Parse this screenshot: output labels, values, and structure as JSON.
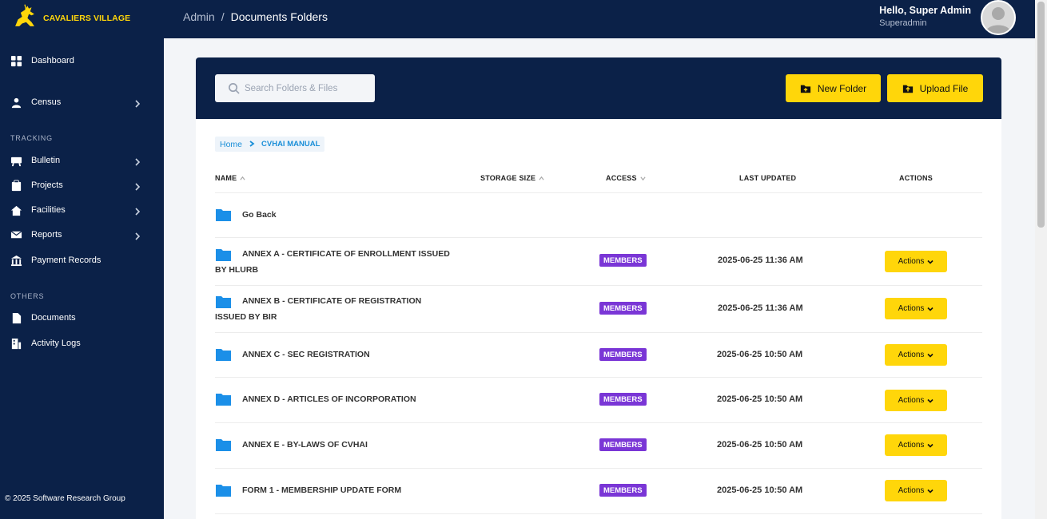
{
  "brand": {
    "name": "CAVALIERS VILLAGE",
    "accent": "#ffd60a",
    "navy": "#0b2148"
  },
  "sidebar": {
    "items": [
      {
        "label": "Dashboard",
        "icon": "grid-icon",
        "has_children": false
      },
      {
        "label": "Census",
        "icon": "person-icon",
        "has_children": true
      }
    ],
    "section_tracking": "TRACKING",
    "tracking_items": [
      {
        "label": "Bulletin",
        "icon": "easel-icon",
        "has_children": true
      },
      {
        "label": "Projects",
        "icon": "clipboard-icon",
        "has_children": true
      },
      {
        "label": "Facilities",
        "icon": "house-icon",
        "has_children": true
      },
      {
        "label": "Reports",
        "icon": "mail-check-icon",
        "has_children": true
      },
      {
        "label": "Payment Records",
        "icon": "bank-icon",
        "has_children": false
      }
    ],
    "section_others": "OTHERS",
    "others_items": [
      {
        "label": "Documents",
        "icon": "document-icon",
        "has_children": false
      },
      {
        "label": "Activity Logs",
        "icon": "building-icon",
        "has_children": false
      }
    ],
    "copyright": "© 2025 Software Research Group"
  },
  "header": {
    "crumb_root": "Admin",
    "crumb_sep": "/",
    "crumb_current": "Documents Folders",
    "greeting": "Hello, Super Admin",
    "role": "Superadmin"
  },
  "toolbar": {
    "search_placeholder": "Search Folders & Files",
    "new_folder": "New Folder",
    "upload_file": "Upload File"
  },
  "breadcrumb": {
    "home": "Home",
    "current": "CVHAI MANUAL"
  },
  "table": {
    "headers": {
      "name": "NAME",
      "size": "STORAGE SIZE",
      "access": "ACCESS",
      "updated": "LAST UPDATED",
      "actions": "ACTIONS"
    },
    "go_back": "Go Back",
    "rows": [
      {
        "name_line1": "ANNEX A - CERTIFICATE OF ENROLLMENT ISSUED",
        "name_line2": "BY HLURB",
        "access": "MEMBERS",
        "updated": "2025-06-25 11:36 AM",
        "action": "Actions"
      },
      {
        "name_line1": "ANNEX B - CERTIFICATE OF REGISTRATION",
        "name_line2": "ISSUED BY BIR",
        "access": "MEMBERS",
        "updated": "2025-06-25 11:36 AM",
        "action": "Actions"
      },
      {
        "name_line1": "ANNEX C - SEC REGISTRATION",
        "name_line2": "",
        "access": "MEMBERS",
        "updated": "2025-06-25 10:50 AM",
        "action": "Actions"
      },
      {
        "name_line1": "ANNEX D - ARTICLES OF INCORPORATION",
        "name_line2": "",
        "access": "MEMBERS",
        "updated": "2025-06-25 10:50 AM",
        "action": "Actions"
      },
      {
        "name_line1": "ANNEX E - BY-LAWS OF CVHAI",
        "name_line2": "",
        "access": "MEMBERS",
        "updated": "2025-06-25 10:50 AM",
        "action": "Actions"
      },
      {
        "name_line1": "FORM 1 - MEMBERSHIP UPDATE FORM",
        "name_line2": "",
        "access": "MEMBERS",
        "updated": "2025-06-25 10:50 AM",
        "action": "Actions"
      }
    ]
  }
}
